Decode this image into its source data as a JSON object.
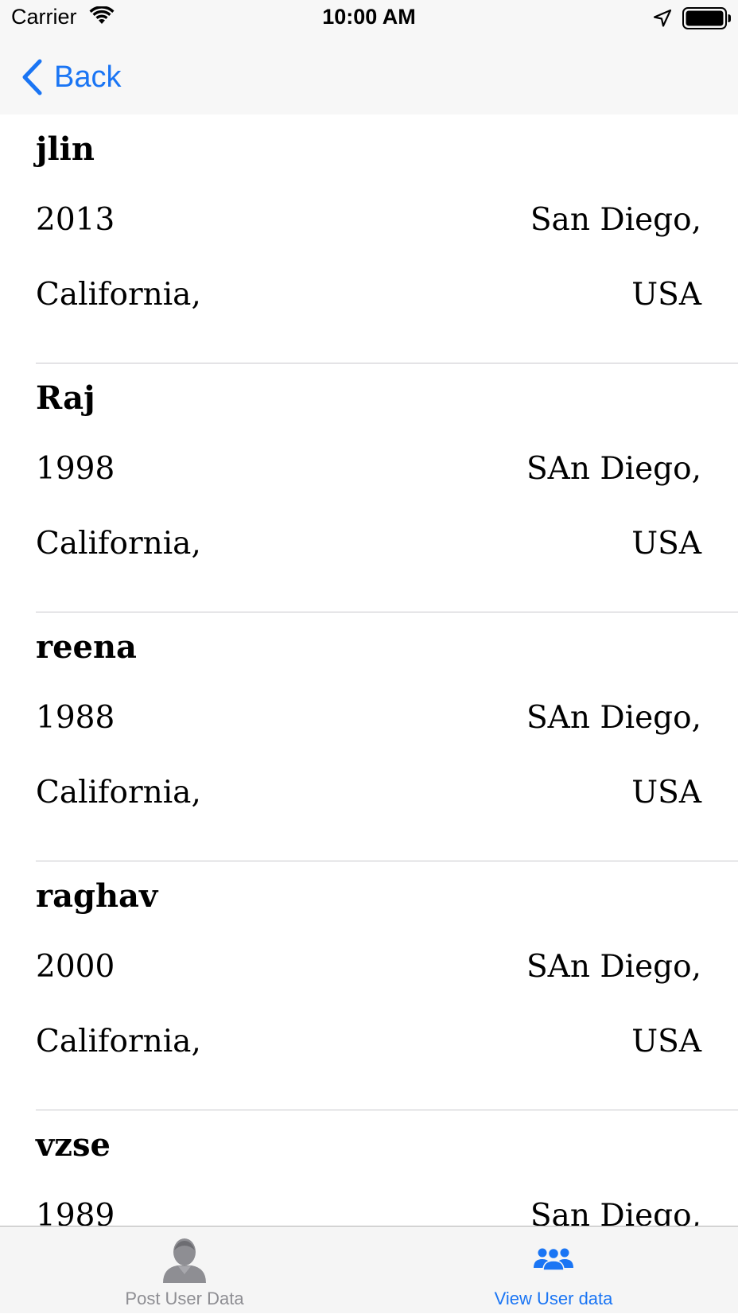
{
  "status_bar": {
    "carrier": "Carrier",
    "time": "10:00 AM",
    "icons": [
      "wifi-icon",
      "location-arrow-icon",
      "battery-icon"
    ]
  },
  "nav": {
    "back_label": "Back",
    "back_icon": "chevron-left-icon",
    "accent_color": "#1a75f4"
  },
  "users": [
    {
      "name": "jlin",
      "year": "2013",
      "city": "San Diego,",
      "state": "California,",
      "country": "USA"
    },
    {
      "name": "Raj",
      "year": "1998",
      "city": "SAn Diego,",
      "state": "California,",
      "country": "USA"
    },
    {
      "name": "reena",
      "year": "1988",
      "city": "SAn Diego,",
      "state": "California,",
      "country": "USA"
    },
    {
      "name": "raghav",
      "year": "2000",
      "city": "SAn Diego,",
      "state": "California,",
      "country": "USA"
    },
    {
      "name": "vzse",
      "year": "1989",
      "city": "San Diego,",
      "state": "",
      "country": ""
    }
  ],
  "tab_bar": {
    "tabs": [
      {
        "label": "Post User Data",
        "icon": "person-icon",
        "selected": false
      },
      {
        "label": "View User data",
        "icon": "group-icon",
        "selected": true
      }
    ],
    "selected_color": "#1a75f4",
    "unselected_color": "#8e8e93"
  }
}
